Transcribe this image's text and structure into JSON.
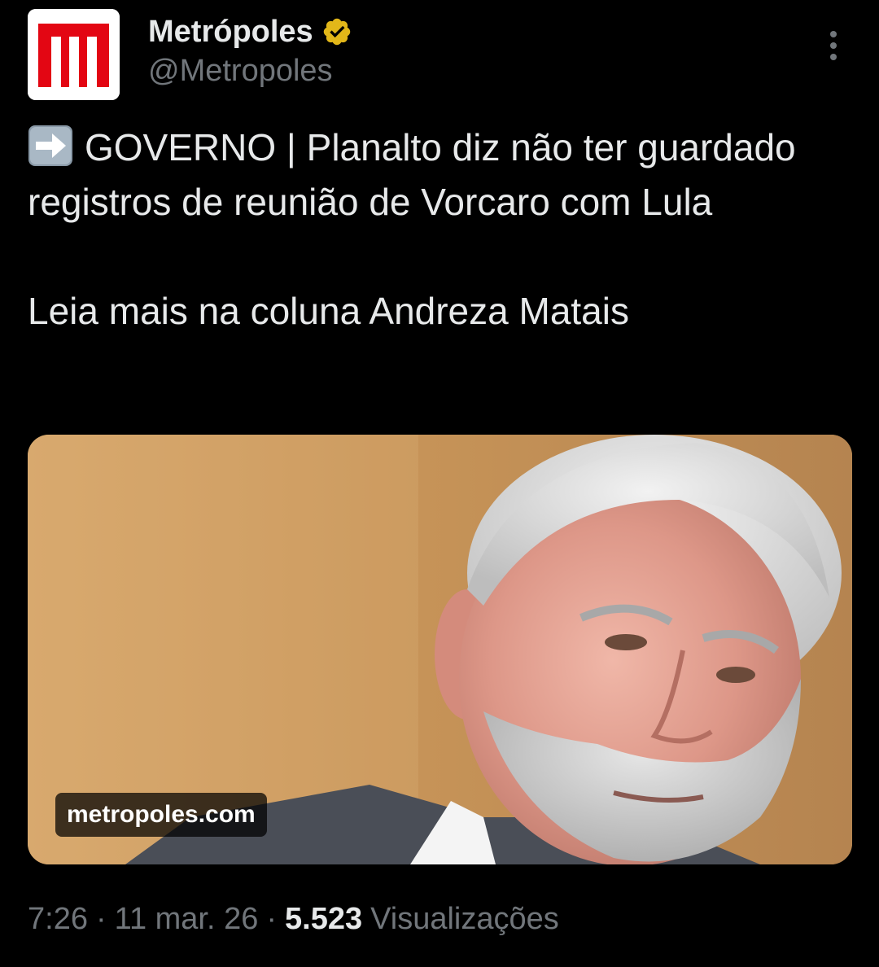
{
  "author": {
    "display_name": "Metrópoles",
    "handle": "@Metropoles",
    "avatar_letter": "M",
    "verified_icon": "verified-badge-icon",
    "brand_color": "#e30613",
    "verified_color": "#e2b719"
  },
  "more_icon": "more-options-icon",
  "tweet": {
    "emoji_icon": "right-arrow-emoji-icon",
    "line1": "GOVERNO | Planalto diz não ter guardado registros de reunião de Vorcaro com Lula",
    "line2": "Leia mais na coluna Andreza Matais"
  },
  "card": {
    "domain": "metropoles.com",
    "image": "photo-of-gray-bearded-man"
  },
  "meta": {
    "time": "7:26",
    "separator": "·",
    "date": "11 mar. 26",
    "views_count": "5.523",
    "views_label": "Visualizações"
  },
  "colors": {
    "background": "#000000",
    "primary_text": "#e7e9ea",
    "secondary_text": "#71767b"
  }
}
